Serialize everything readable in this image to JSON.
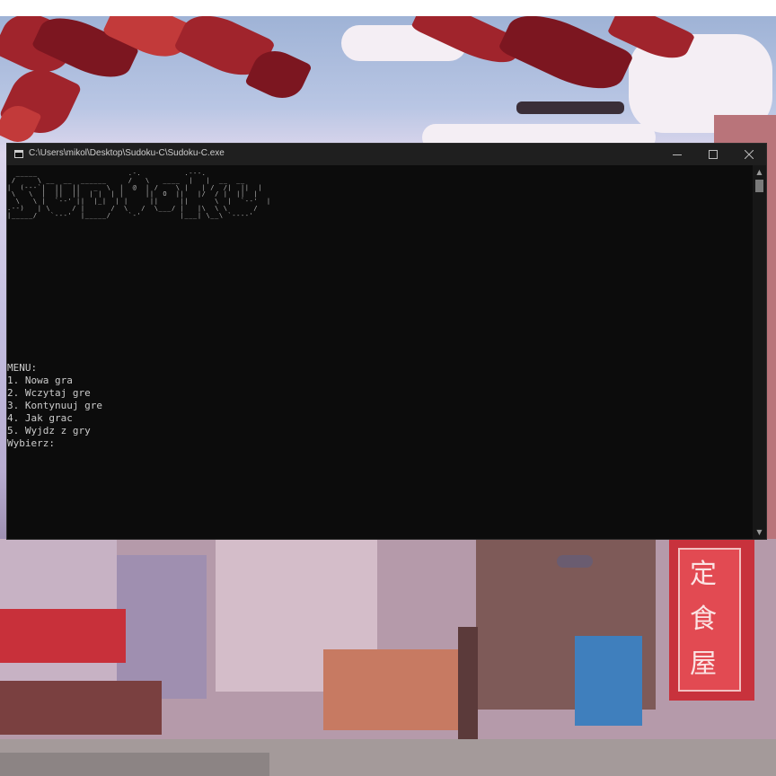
{
  "window": {
    "title": "C:\\Users\\mikol\\Desktop\\Sudoku-C\\Sudoku-C.exe",
    "icon": "console-app-icon"
  },
  "ascii_logo": "  _____                     .-.          .---.\n /     \\ __  __  ______     /   \\   ____  |   |  __  __\n|  (---`|  ||  ||   _  \\  |  @  | /    \\ |   | /  /|  ||  |\n \\   \\  |  ||  ||  | |  | |     ||  O  ||   |/  / |  ||  |\n  \\   \\ |  `--' ||  |_|  | |     ||     ||      \\  |  `--'  |\n.--)   | \\     / |      /  \\   /  \\___/ |   |\\  \\ \\      /\n|_____/   `---'  |_____/    `-'         |___| \\__\\ `----'",
  "menu": {
    "header": "MENU:",
    "options": [
      "1. Nowa gra",
      "2. Wczytaj gre",
      "3. Kontynuuj gre",
      "4. Jak grac",
      "5. Wyjdz z gry"
    ],
    "prompt": "Wybierz:"
  },
  "wallpaper_signs": [
    "定",
    "食",
    "屋"
  ],
  "colors": {
    "console_bg": "#0c0c0c",
    "console_text": "#cccccc",
    "titlebar_bg": "#1f1f1f"
  }
}
